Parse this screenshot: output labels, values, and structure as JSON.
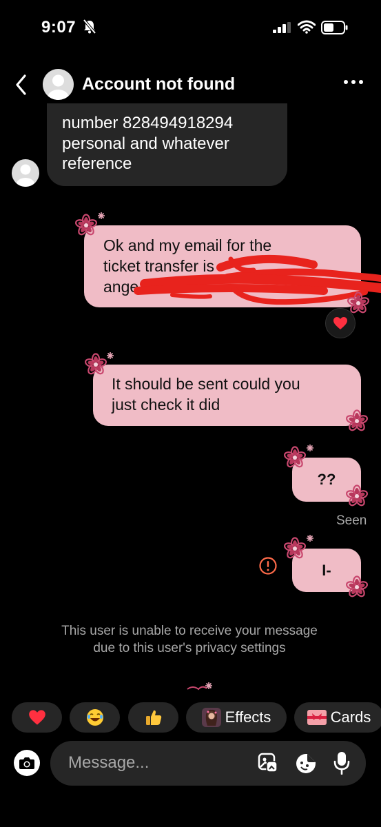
{
  "status_bar": {
    "time": "9:07"
  },
  "header": {
    "title": "Account not found"
  },
  "messages": {
    "incoming_lines": [
      "number 828494918294",
      "personal and whatever",
      "reference"
    ],
    "outgoing_1_lines": [
      "Ok and my email for the",
      "ticket transfer is",
      "ange"
    ],
    "outgoing_2_lines": [
      "It should be sent could you",
      "just check it did"
    ],
    "outgoing_3": "??",
    "outgoing_4": "I-",
    "reaction": "heart",
    "seen_label": "Seen"
  },
  "notice": {
    "line1": "This user is unable to receive your message",
    "line2": "due to this user's privacy settings"
  },
  "quick_reactions": {
    "effects_label": "Effects",
    "cards_label": "Cards"
  },
  "composer": {
    "placeholder": "Message..."
  },
  "colors": {
    "outgoing_bubble": "#f0bcc6",
    "incoming_bubble": "#262626",
    "flower": "#c9486f",
    "error": "#ff6b4a",
    "redaction": "#e8231d"
  }
}
